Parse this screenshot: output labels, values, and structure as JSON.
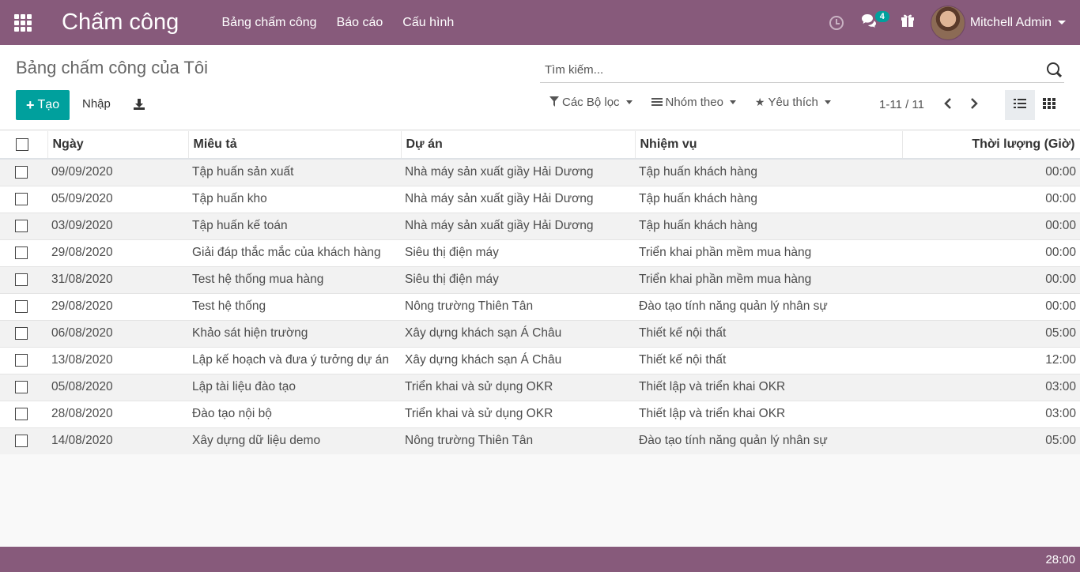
{
  "app": {
    "title": "Chấm công"
  },
  "nav": {
    "menu": [
      "Bảng chấm công",
      "Báo cáo",
      "Cấu hình"
    ],
    "messages_count": "4",
    "user": "Mitchell Admin"
  },
  "control": {
    "breadcrumb": "Bảng chấm công của Tôi",
    "search_placeholder": "Tìm kiếm...",
    "create_label": "Tạo",
    "import_label": "Nhập",
    "filters_label": "Các Bộ lọc",
    "group_label": "Nhóm theo",
    "favorites_label": "Yêu thích",
    "pager": "1-11 / 11"
  },
  "table": {
    "columns": [
      "Ngày",
      "Miêu tả",
      "Dự án",
      "Nhiệm vụ",
      "Thời lượng (Giờ)"
    ],
    "rows": [
      [
        "09/09/2020",
        "Tập huấn sản xuất",
        "Nhà máy sản xuất giầy Hải Dương",
        "Tập huấn khách hàng",
        "00:00"
      ],
      [
        "05/09/2020",
        "Tập huấn kho",
        "Nhà máy sản xuất giầy Hải Dương",
        "Tập huấn khách hàng",
        "00:00"
      ],
      [
        "03/09/2020",
        "Tập huấn kế toán",
        "Nhà máy sản xuất giầy Hải Dương",
        "Tập huấn khách hàng",
        "00:00"
      ],
      [
        "29/08/2020",
        "Giải đáp thắc mắc của khách hàng",
        "Siêu thị điện máy",
        "Triển khai phần mềm mua hàng",
        "00:00"
      ],
      [
        "31/08/2020",
        "Test hệ thống mua hàng",
        "Siêu thị điện máy",
        "Triển khai phần mềm mua hàng",
        "00:00"
      ],
      [
        "29/08/2020",
        "Test hệ thống",
        "Nông trường Thiên Tân",
        "Đào tạo tính năng quản lý nhân sự",
        "00:00"
      ],
      [
        "06/08/2020",
        "Khảo sát hiện trường",
        "Xây dựng khách sạn Á Châu",
        "Thiết kế nội thất",
        "05:00"
      ],
      [
        "13/08/2020",
        "Lập kế hoạch và đưa ý tưởng dự án",
        "Xây dựng khách sạn Á Châu",
        "Thiết kế nội thất",
        "12:00"
      ],
      [
        "05/08/2020",
        "Lập tài liệu đào tạo",
        "Triển khai và sử dụng OKR",
        "Thiết lập và triển khai OKR",
        "03:00"
      ],
      [
        "28/08/2020",
        "Đào tạo nội bộ",
        "Triển khai và sử dụng OKR",
        "Thiết lập và triển khai OKR",
        "03:00"
      ],
      [
        "14/08/2020",
        "Xây dựng dữ liệu demo",
        "Nông trường Thiên Tân",
        "Đào tạo tính năng quản lý nhân sự",
        "05:00"
      ]
    ]
  },
  "footer": {
    "total": "28:00"
  },
  "colors": {
    "brand": "#875a7b",
    "accent": "#00a09d"
  }
}
